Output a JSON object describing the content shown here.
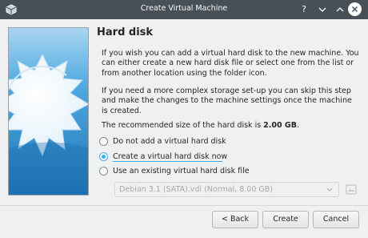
{
  "window": {
    "title": "Create Virtual Machine"
  },
  "titlebar": {
    "help_icon": "help-icon",
    "minimize_icon": "chevron-down-icon",
    "maximize_icon": "chevron-up-icon",
    "close_icon": "close-icon"
  },
  "page": {
    "heading": "Hard disk",
    "paragraph1": "If you wish you can add a virtual hard disk to the new machine. You can either create a new hard disk file or select one from the list or from another location using the folder icon.",
    "paragraph2": "If you need a more complex storage set-up you can skip this step and make the changes to the machine settings once the machine is created.",
    "recommended_prefix": "The recommended size of the hard disk is ",
    "recommended_size": "2.00 GB",
    "recommended_suffix": "."
  },
  "options": [
    {
      "label": "Do not add a virtual hard disk",
      "checked": false
    },
    {
      "label": "Create a virtual hard disk now",
      "checked": true
    },
    {
      "label": "Use an existing virtual hard disk file",
      "checked": false
    }
  ],
  "existing_disk": {
    "selected": "Debian 3.1 (SATA).vdi (Normal, 8.00 GB)",
    "enabled": false
  },
  "buttons": {
    "back": "< Back",
    "create": "Create",
    "cancel": "Cancel"
  },
  "colors": {
    "titlebar": "#475057",
    "accent": "#3daee9",
    "background": "#eff0f1",
    "banner_sky": "#3b9fd6"
  }
}
